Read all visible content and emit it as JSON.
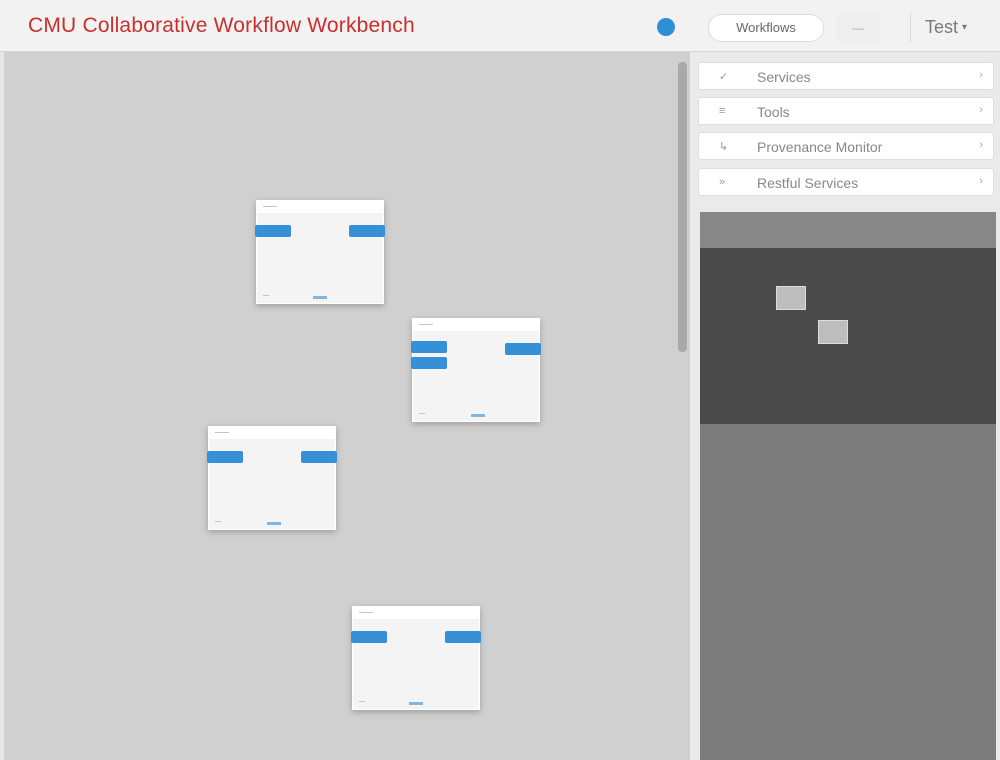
{
  "header": {
    "title": "CMU Collaborative Workflow Workbench",
    "workflows_label": "Workflows",
    "small_button_label": "—",
    "user_label": "Test",
    "user_caret": "▾",
    "status_color": "#2d8fd6"
  },
  "nodes": [
    {
      "title": "——",
      "footer": "—"
    },
    {
      "title": "——",
      "footer": "—"
    },
    {
      "title": "——",
      "footer": "—"
    },
    {
      "title": "——",
      "footer": "—"
    }
  ],
  "side_panel": {
    "sections": [
      {
        "icon": "✓",
        "label": "Services",
        "chevron": "›"
      },
      {
        "icon": "≡",
        "label": "Tools",
        "chevron": "›"
      },
      {
        "icon": "↳",
        "label": "Provenance Monitor",
        "chevron": "›"
      },
      {
        "icon": "»",
        "label": "Restful Services",
        "chevron": "›"
      }
    ]
  },
  "colors": {
    "accent": "#3590d8",
    "title": "#c8302f",
    "canvas": "#d0d0d0"
  }
}
